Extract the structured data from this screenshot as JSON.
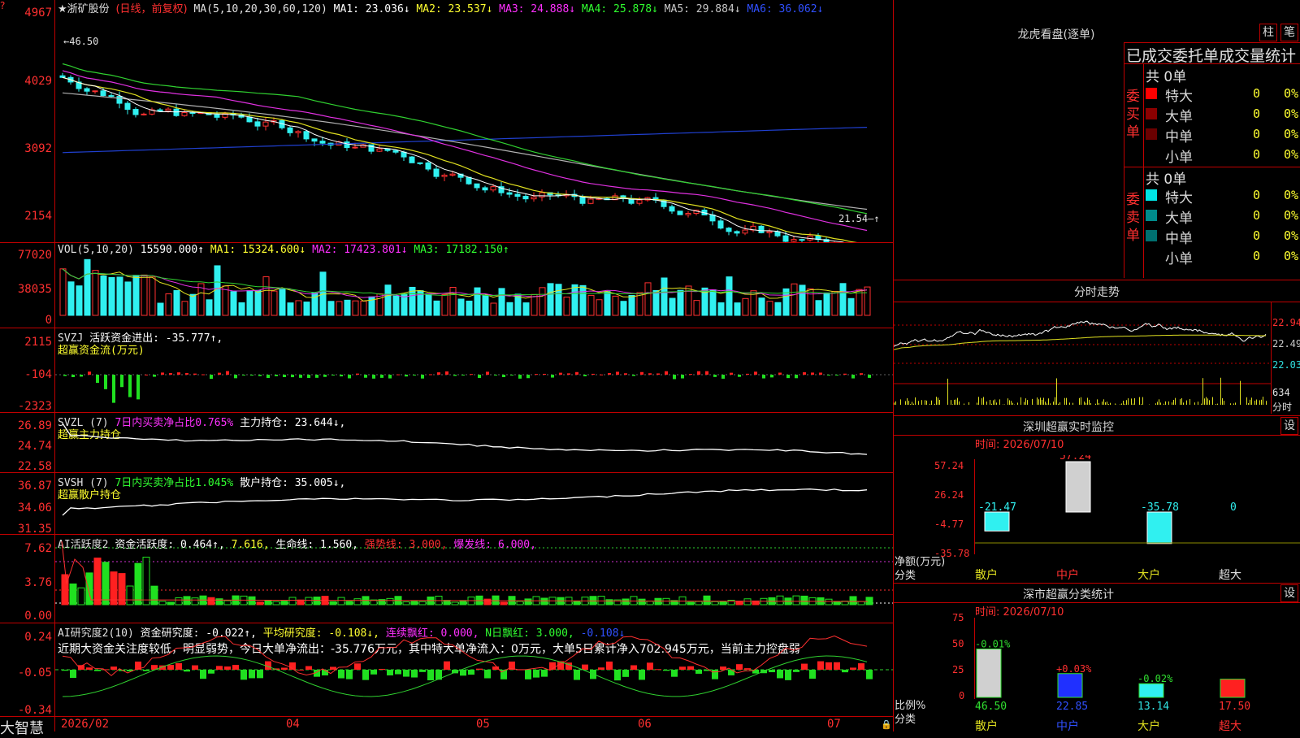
{
  "header": {
    "stock_name": "★浙矿股份",
    "period": "(日线，前复权)",
    "ma_label": "MA(5,10,20,30,60,120)",
    "ma1": "MA1: 23.036↓",
    "ma2": "MA2: 23.537↓",
    "ma3": "MA3: 24.888↓",
    "ma4": "MA4: 25.878↓",
    "ma5": "MA5: 29.884↓",
    "ma6": "MA6: 36.062↓"
  },
  "price_axis": [
    "4967",
    "4029",
    "3092",
    "2154"
  ],
  "price_marks": {
    "high": "46.50",
    "low": "21.54"
  },
  "vol": {
    "label": "VOL(5,10,20)",
    "value": "15590.000↑",
    "ma1": "MA1: 15324.600↓",
    "ma2": "MA2: 17423.801↓",
    "ma3": "MA3: 17182.150↑",
    "axis": [
      "77020",
      "38035",
      "0"
    ]
  },
  "svzj": {
    "label": "SVZJ",
    "text1": "活跃资金进出: -35.777↑,",
    "text2": "超赢资金流(万元)",
    "axis": [
      "2115",
      "-104",
      "-2323"
    ]
  },
  "svzl": {
    "label": "SVZL (7)",
    "text1": "7日内买卖净占比0.765%",
    "text2": "主力持仓: 23.644↓,",
    "text3": "超赢主力持仓",
    "axis": [
      "26.89",
      "24.74",
      "22.58"
    ]
  },
  "svsh": {
    "label": "SVSH (7)",
    "text1": "7日内买卖净占比1.045%",
    "text2": "散户持仓: 35.005↓,",
    "text3": "超赢散户持仓",
    "axis": [
      "36.87",
      "34.06",
      "31.35"
    ]
  },
  "ai1": {
    "label": "AI活跃度2",
    "t1": "资金活跃度: 0.464↑,",
    "t2": "7.616,",
    "t3": "生命线: 1.560,",
    "t4": "强势线: 3.000,",
    "t5": "爆发线: 6.000,",
    "axis": [
      "7.62",
      "3.76",
      "0.00"
    ]
  },
  "ai2": {
    "label": "AI研究度2(10)",
    "t1": "资金研究度: -0.022↑,",
    "t2": "平均研究度: -0.108↓,",
    "t3": "连续飘红: 0.000,",
    "t4": "N日飘红: 3.000,",
    "t5": "-0.108↓",
    "comment": "近期大资金关注度较低，明显弱势，今日大单净流出：-35.776万元，其中特大单净流入：0万元，大单5日累计净入702.945万元，当前主力控盘弱",
    "axis": [
      "0.24",
      "-0.05",
      "-0.34"
    ]
  },
  "time_axis": [
    "2026/02",
    "04",
    "05",
    "06",
    "07"
  ],
  "footer": {
    "app_name": "大智慧"
  },
  "right_panel": {
    "longhu_title": "龙虎看盘(逐单)",
    "btn_bar": "柱",
    "btn_pen": "笔",
    "stat_title": "已成交委托单成交量统计",
    "buy_side": {
      "label": "委买单",
      "total": "共 0单",
      "rows": [
        {
          "name": "特大",
          "count": "0",
          "pct": "0%",
          "color": "#ff0000"
        },
        {
          "name": "大单",
          "count": "0",
          "pct": "0%",
          "color": "#8b0000"
        },
        {
          "name": "中单",
          "count": "0",
          "pct": "0%",
          "color": "#6b0000"
        },
        {
          "name": "小单",
          "count": "0",
          "pct": "0%",
          "color": "#000000"
        }
      ]
    },
    "sell_side": {
      "label": "委卖单",
      "total": "共 0单",
      "rows": [
        {
          "name": "特大",
          "count": "0",
          "pct": "0%",
          "color": "#00e5e5"
        },
        {
          "name": "大单",
          "count": "0",
          "pct": "0%",
          "color": "#008b8b"
        },
        {
          "name": "中单",
          "count": "0",
          "pct": "0%",
          "color": "#007070"
        },
        {
          "name": "小单",
          "count": "0",
          "pct": "0%",
          "color": "#000000"
        }
      ]
    },
    "intraday": {
      "title": "分时走势",
      "axis": [
        "22.94",
        "22.49",
        "22.03"
      ],
      "vol_label": "634",
      "vol_unit": "分时"
    },
    "monitor": {
      "title": "深圳超赢实时监控",
      "btn": "设",
      "time": "时间: 2026/07/10",
      "axis": [
        "57.24",
        "26.24",
        "-4.77",
        "-35.78"
      ],
      "ylabel": "净额(万元)",
      "xlabel": "分类",
      "categories": [
        "散户",
        "中户",
        "大户",
        "超大"
      ],
      "values": [
        "-21.47",
        "57.24",
        "-35.78",
        "0"
      ]
    },
    "classify": {
      "title": "深市超赢分类统计",
      "btn": "设",
      "time": "时间: 2026/07/10",
      "axis": [
        "75",
        "50",
        "25",
        "0"
      ],
      "ylabel": "比例%",
      "xlabel": "分类",
      "categories": [
        "散户",
        "中户",
        "大户",
        "超大"
      ],
      "values": [
        "46.50",
        "22.85",
        "13.14",
        "17.50"
      ],
      "changes": [
        "-0.01%",
        "+0.03%",
        "-0.02%",
        ""
      ]
    }
  },
  "chart_data": [
    {
      "type": "bar",
      "title": "深圳超赢实时监控",
      "categories": [
        "散户",
        "中户",
        "大户",
        "超大"
      ],
      "values": [
        -21.47,
        57.24,
        -35.78,
        0
      ],
      "ylabel": "净额(万元)",
      "ylim": [
        -35.78,
        57.24
      ]
    },
    {
      "type": "bar",
      "title": "深市超赢分类统计",
      "categories": [
        "散户",
        "中户",
        "大户",
        "超大"
      ],
      "values": [
        46.5,
        22.85,
        13.14,
        17.5
      ],
      "ylabel": "比例%",
      "ylim": [
        0,
        75
      ]
    }
  ]
}
